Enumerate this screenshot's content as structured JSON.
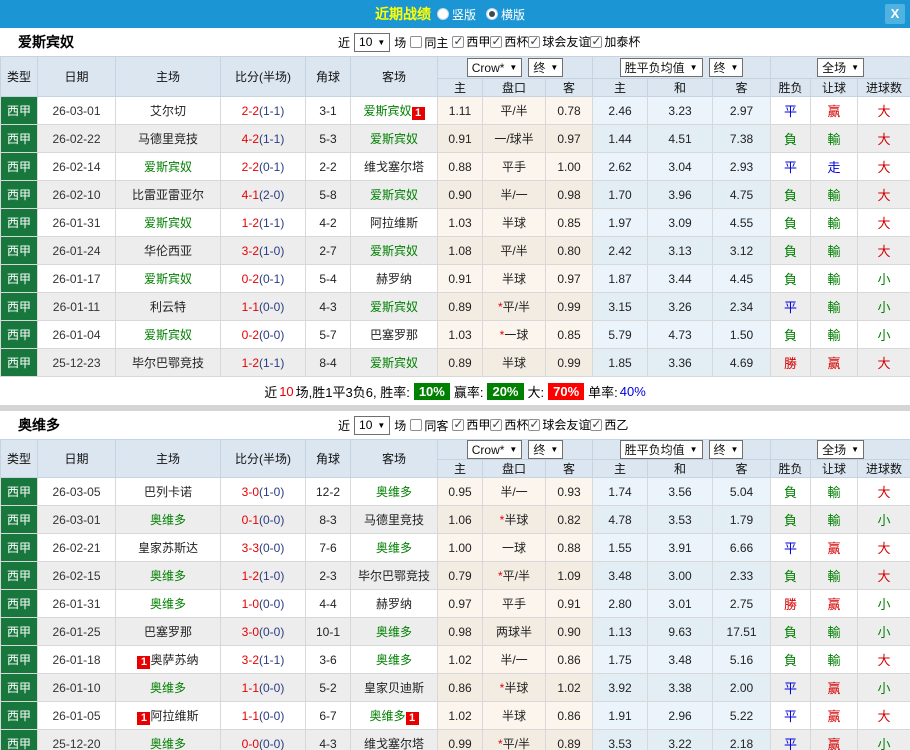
{
  "titlebar": {
    "title": "近期战绩",
    "vertical_label": "竖版",
    "horizontal_label": "横版",
    "selected_mode": "横版",
    "close_label": "X"
  },
  "header": {
    "cols": [
      "类型",
      "日期",
      "主场",
      "比分(半场)",
      "角球",
      "客场"
    ],
    "sub": [
      "主",
      "盘口",
      "客",
      "主",
      "和",
      "客",
      "胜负",
      "让球",
      "进球数"
    ],
    "dd_odds": "Crow*",
    "dd_final1": "终",
    "dd_avg": "胜平负均值",
    "dd_final2": "终",
    "dd_full": "全场"
  },
  "colors": {
    "topbar": "#1b95d4",
    "type_green": "#17773d",
    "team_green": "#008000",
    "score_red": "#e80000",
    "half_navy": "#2b3d80",
    "result_red": "#d40000",
    "result_green": "#008000",
    "result_blue": "#0000d8"
  },
  "result_color_map": {
    "勝": "red",
    "赢": "red",
    "大": "red",
    "負": "green",
    "輸": "green",
    "小": "green",
    "平": "blue",
    "走": "blue"
  },
  "sections": [
    {
      "team": "爱斯宾奴",
      "near_label": "近",
      "near_value": "10",
      "games_label": "场",
      "same_label": "同主",
      "same_checked": false,
      "filters": [
        "西甲",
        "西杯",
        "球会友谊",
        "加泰杯"
      ],
      "rows": [
        {
          "league": "西甲",
          "date": "26-03-01",
          "home": "艾尔切",
          "home_green": false,
          "home_badge": "",
          "score": "2-2",
          "half": "(1-1)",
          "corners": "3-1",
          "away": "爱斯宾奴",
          "away_green": true,
          "away_badge": "1",
          "odds_home": "1.11",
          "handicap": "平/半",
          "handicap_live": false,
          "odds_away": "0.78",
          "avg_home": "2.46",
          "avg_draw": "3.23",
          "avg_away": "2.97",
          "res_wdl": "平",
          "res_handicap": "赢",
          "res_goals": "大"
        },
        {
          "league": "西甲",
          "date": "26-02-22",
          "home": "马德里竞技",
          "home_green": false,
          "home_badge": "",
          "score": "4-2",
          "half": "(1-1)",
          "corners": "5-3",
          "away": "爱斯宾奴",
          "away_green": true,
          "away_badge": "",
          "odds_home": "0.91",
          "handicap": "一/球半",
          "handicap_live": false,
          "odds_away": "0.97",
          "avg_home": "1.44",
          "avg_draw": "4.51",
          "avg_away": "7.38",
          "res_wdl": "負",
          "res_handicap": "輸",
          "res_goals": "大"
        },
        {
          "league": "西甲",
          "date": "26-02-14",
          "home": "爱斯宾奴",
          "home_green": true,
          "home_badge": "",
          "score": "2-2",
          "half": "(0-1)",
          "corners": "2-2",
          "away": "维戈塞尔塔",
          "away_green": false,
          "away_badge": "",
          "odds_home": "0.88",
          "handicap": "平手",
          "handicap_live": false,
          "odds_away": "1.00",
          "avg_home": "2.62",
          "avg_draw": "3.04",
          "avg_away": "2.93",
          "res_wdl": "平",
          "res_handicap": "走",
          "res_goals": "大"
        },
        {
          "league": "西甲",
          "date": "26-02-10",
          "home": "比雷亚雷亚尔",
          "home_green": false,
          "home_badge": "",
          "score": "4-1",
          "half": "(2-0)",
          "corners": "5-8",
          "away": "爱斯宾奴",
          "away_green": true,
          "away_badge": "",
          "odds_home": "0.90",
          "handicap": "半/一",
          "handicap_live": false,
          "odds_away": "0.98",
          "avg_home": "1.70",
          "avg_draw": "3.96",
          "avg_away": "4.75",
          "res_wdl": "負",
          "res_handicap": "輸",
          "res_goals": "大"
        },
        {
          "league": "西甲",
          "date": "26-01-31",
          "home": "爱斯宾奴",
          "home_green": true,
          "home_badge": "",
          "score": "1-2",
          "half": "(1-1)",
          "corners": "4-2",
          "away": "阿拉维斯",
          "away_green": false,
          "away_badge": "",
          "odds_home": "1.03",
          "handicap": "半球",
          "handicap_live": false,
          "odds_away": "0.85",
          "avg_home": "1.97",
          "avg_draw": "3.09",
          "avg_away": "4.55",
          "res_wdl": "負",
          "res_handicap": "輸",
          "res_goals": "大"
        },
        {
          "league": "西甲",
          "date": "26-01-24",
          "home": "华伦西亚",
          "home_green": false,
          "home_badge": "",
          "score": "3-2",
          "half": "(1-0)",
          "corners": "2-7",
          "away": "爱斯宾奴",
          "away_green": true,
          "away_badge": "",
          "odds_home": "1.08",
          "handicap": "平/半",
          "handicap_live": false,
          "odds_away": "0.80",
          "avg_home": "2.42",
          "avg_draw": "3.13",
          "avg_away": "3.12",
          "res_wdl": "負",
          "res_handicap": "輸",
          "res_goals": "大"
        },
        {
          "league": "西甲",
          "date": "26-01-17",
          "home": "爱斯宾奴",
          "home_green": true,
          "home_badge": "",
          "score": "0-2",
          "half": "(0-1)",
          "corners": "5-4",
          "away": "赫罗纳",
          "away_green": false,
          "away_badge": "",
          "odds_home": "0.91",
          "handicap": "半球",
          "handicap_live": false,
          "odds_away": "0.97",
          "avg_home": "1.87",
          "avg_draw": "3.44",
          "avg_away": "4.45",
          "res_wdl": "負",
          "res_handicap": "輸",
          "res_goals": "小"
        },
        {
          "league": "西甲",
          "date": "26-01-11",
          "home": "利云特",
          "home_green": false,
          "home_badge": "",
          "score": "1-1",
          "half": "(0-0)",
          "corners": "4-3",
          "away": "爱斯宾奴",
          "away_green": true,
          "away_badge": "",
          "odds_home": "0.89",
          "handicap": "平/半",
          "handicap_live": true,
          "odds_away": "0.99",
          "avg_home": "3.15",
          "avg_draw": "3.26",
          "avg_away": "2.34",
          "res_wdl": "平",
          "res_handicap": "輸",
          "res_goals": "小"
        },
        {
          "league": "西甲",
          "date": "26-01-04",
          "home": "爱斯宾奴",
          "home_green": true,
          "home_badge": "",
          "score": "0-2",
          "half": "(0-0)",
          "corners": "5-7",
          "away": "巴塞罗那",
          "away_green": false,
          "away_badge": "",
          "odds_home": "1.03",
          "handicap": "一球",
          "handicap_live": true,
          "odds_away": "0.85",
          "avg_home": "5.79",
          "avg_draw": "4.73",
          "avg_away": "1.50",
          "res_wdl": "負",
          "res_handicap": "輸",
          "res_goals": "小"
        },
        {
          "league": "西甲",
          "date": "25-12-23",
          "home": "毕尔巴鄂竞技",
          "home_green": false,
          "home_badge": "",
          "score": "1-2",
          "half": "(1-1)",
          "corners": "8-4",
          "away": "爱斯宾奴",
          "away_green": true,
          "away_badge": "",
          "odds_home": "0.89",
          "handicap": "半球",
          "handicap_live": false,
          "odds_away": "0.99",
          "avg_home": "1.85",
          "avg_draw": "3.36",
          "avg_away": "4.69",
          "res_wdl": "勝",
          "res_handicap": "赢",
          "res_goals": "大"
        }
      ],
      "summary": {
        "prefix": "近",
        "count": "10",
        "mid": "场,胜1平3负6, 胜率:",
        "win_pct": "10%",
        "label_win": "赢率:",
        "winh_pct": "20%",
        "label_big": "大:",
        "big_pct": "70%",
        "label_single": "单率:",
        "single_pct": "40%"
      }
    },
    {
      "team": "奥维多",
      "near_label": "近",
      "near_value": "10",
      "games_label": "场",
      "same_label": "同客",
      "same_checked": false,
      "filters": [
        "西甲",
        "西杯",
        "球会友谊",
        "西乙"
      ],
      "rows": [
        {
          "league": "西甲",
          "date": "26-03-05",
          "home": "巴列卡诺",
          "home_green": false,
          "home_badge": "",
          "score": "3-0",
          "half": "(1-0)",
          "corners": "12-2",
          "away": "奥维多",
          "away_green": true,
          "away_badge": "",
          "odds_home": "0.95",
          "handicap": "半/一",
          "handicap_live": false,
          "odds_away": "0.93",
          "avg_home": "1.74",
          "avg_draw": "3.56",
          "avg_away": "5.04",
          "res_wdl": "負",
          "res_handicap": "輸",
          "res_goals": "大"
        },
        {
          "league": "西甲",
          "date": "26-03-01",
          "home": "奥维多",
          "home_green": true,
          "home_badge": "",
          "score": "0-1",
          "half": "(0-0)",
          "corners": "8-3",
          "away": "马德里竞技",
          "away_green": false,
          "away_badge": "",
          "odds_home": "1.06",
          "handicap": "半球",
          "handicap_live": true,
          "odds_away": "0.82",
          "avg_home": "4.78",
          "avg_draw": "3.53",
          "avg_away": "1.79",
          "res_wdl": "負",
          "res_handicap": "輸",
          "res_goals": "小"
        },
        {
          "league": "西甲",
          "date": "26-02-21",
          "home": "皇家苏斯达",
          "home_green": false,
          "home_badge": "",
          "score": "3-3",
          "half": "(0-0)",
          "corners": "7-6",
          "away": "奥维多",
          "away_green": true,
          "away_badge": "",
          "odds_home": "1.00",
          "handicap": "一球",
          "handicap_live": false,
          "odds_away": "0.88",
          "avg_home": "1.55",
          "avg_draw": "3.91",
          "avg_away": "6.66",
          "res_wdl": "平",
          "res_handicap": "赢",
          "res_goals": "大"
        },
        {
          "league": "西甲",
          "date": "26-02-15",
          "home": "奥维多",
          "home_green": true,
          "home_badge": "",
          "score": "1-2",
          "half": "(1-0)",
          "corners": "2-3",
          "away": "毕尔巴鄂竞技",
          "away_green": false,
          "away_badge": "",
          "odds_home": "0.79",
          "handicap": "平/半",
          "handicap_live": true,
          "odds_away": "1.09",
          "avg_home": "3.48",
          "avg_draw": "3.00",
          "avg_away": "2.33",
          "res_wdl": "負",
          "res_handicap": "輸",
          "res_goals": "大"
        },
        {
          "league": "西甲",
          "date": "26-01-31",
          "home": "奥维多",
          "home_green": true,
          "home_badge": "",
          "score": "1-0",
          "half": "(0-0)",
          "corners": "4-4",
          "away": "赫罗纳",
          "away_green": false,
          "away_badge": "",
          "odds_home": "0.97",
          "handicap": "平手",
          "handicap_live": false,
          "odds_away": "0.91",
          "avg_home": "2.80",
          "avg_draw": "3.01",
          "avg_away": "2.75",
          "res_wdl": "勝",
          "res_handicap": "赢",
          "res_goals": "小"
        },
        {
          "league": "西甲",
          "date": "26-01-25",
          "home": "巴塞罗那",
          "home_green": false,
          "home_badge": "",
          "score": "3-0",
          "half": "(0-0)",
          "corners": "10-1",
          "away": "奥维多",
          "away_green": true,
          "away_badge": "",
          "odds_home": "0.98",
          "handicap": "两球半",
          "handicap_live": false,
          "odds_away": "0.90",
          "avg_home": "1.13",
          "avg_draw": "9.63",
          "avg_away": "17.51",
          "res_wdl": "負",
          "res_handicap": "輸",
          "res_goals": "小"
        },
        {
          "league": "西甲",
          "date": "26-01-18",
          "home": "奥萨苏纳",
          "home_green": false,
          "home_badge": "1",
          "score": "3-2",
          "half": "(1-1)",
          "corners": "3-6",
          "away": "奥维多",
          "away_green": true,
          "away_badge": "",
          "odds_home": "1.02",
          "handicap": "半/一",
          "handicap_live": false,
          "odds_away": "0.86",
          "avg_home": "1.75",
          "avg_draw": "3.48",
          "avg_away": "5.16",
          "res_wdl": "負",
          "res_handicap": "輸",
          "res_goals": "大"
        },
        {
          "league": "西甲",
          "date": "26-01-10",
          "home": "奥维多",
          "home_green": true,
          "home_badge": "",
          "score": "1-1",
          "half": "(0-0)",
          "corners": "5-2",
          "away": "皇家贝迪斯",
          "away_green": false,
          "away_badge": "",
          "odds_home": "0.86",
          "handicap": "半球",
          "handicap_live": true,
          "odds_away": "1.02",
          "avg_home": "3.92",
          "avg_draw": "3.38",
          "avg_away": "2.00",
          "res_wdl": "平",
          "res_handicap": "赢",
          "res_goals": "小"
        },
        {
          "league": "西甲",
          "date": "26-01-05",
          "home": "阿拉维斯",
          "home_green": false,
          "home_badge": "1",
          "score": "1-1",
          "half": "(0-0)",
          "corners": "6-7",
          "away": "奥维多",
          "away_green": true,
          "away_badge": "1",
          "odds_home": "1.02",
          "handicap": "半球",
          "handicap_live": false,
          "odds_away": "0.86",
          "avg_home": "1.91",
          "avg_draw": "2.96",
          "avg_away": "5.22",
          "res_wdl": "平",
          "res_handicap": "赢",
          "res_goals": "大"
        },
        {
          "league": "西甲",
          "date": "25-12-20",
          "home": "奥维多",
          "home_green": true,
          "home_badge": "",
          "score": "0-0",
          "half": "(0-0)",
          "corners": "4-3",
          "away": "维戈塞尔塔",
          "away_green": false,
          "away_badge": "",
          "odds_home": "0.99",
          "handicap": "平/半",
          "handicap_live": true,
          "odds_away": "0.89",
          "avg_home": "3.53",
          "avg_draw": "3.22",
          "avg_away": "2.18",
          "res_wdl": "平",
          "res_handicap": "赢",
          "res_goals": "小"
        }
      ],
      "summary": null
    }
  ]
}
